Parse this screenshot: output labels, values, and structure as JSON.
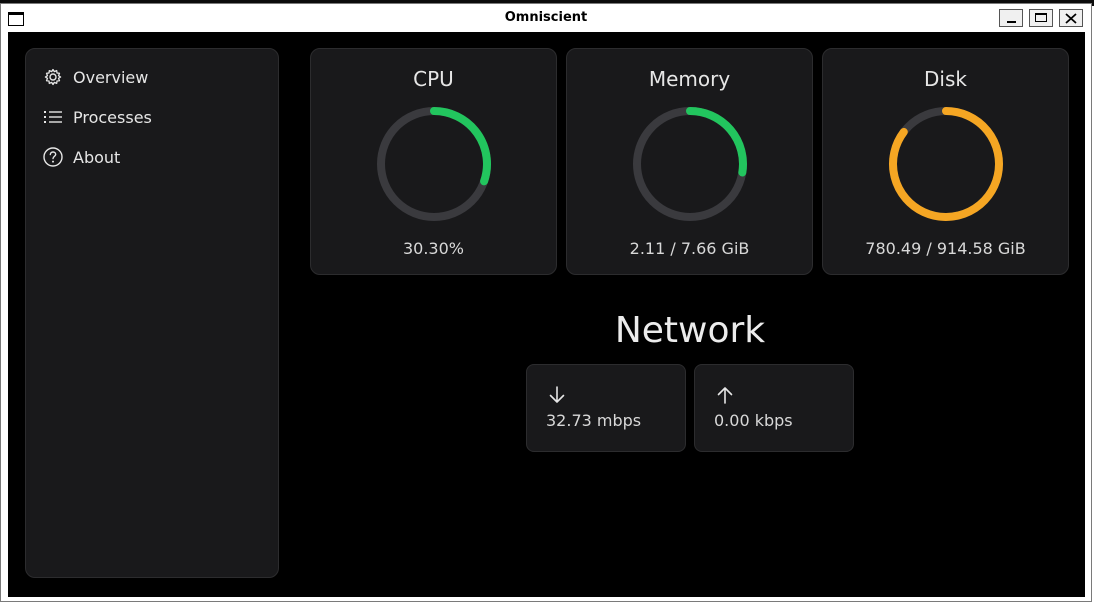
{
  "window": {
    "title": "Omniscient"
  },
  "sidebar": {
    "items": [
      {
        "label": "Overview",
        "icon": "gear-icon"
      },
      {
        "label": "Processes",
        "icon": "list-icon"
      },
      {
        "label": "About",
        "icon": "help-circle-icon"
      }
    ]
  },
  "gauges": {
    "cpu": {
      "label": "CPU",
      "value": "30.30%",
      "fraction": 0.303,
      "color": "#22c55e"
    },
    "memory": {
      "label": "Memory",
      "value": "2.11 / 7.66 GiB",
      "fraction": 0.2755,
      "color": "#22c55e"
    },
    "disk": {
      "label": "Disk",
      "value": "780.49 / 914.58 GiB",
      "fraction": 0.8534,
      "color": "#f5a623"
    }
  },
  "network": {
    "title": "Network",
    "download": {
      "value": "32.73 mbps",
      "icon": "arrow-down-icon"
    },
    "upload": {
      "value": "0.00 kbps",
      "icon": "arrow-up-icon"
    }
  },
  "colors": {
    "track": "#3a3a3e",
    "panel": "#19191b",
    "background": "#000000"
  }
}
